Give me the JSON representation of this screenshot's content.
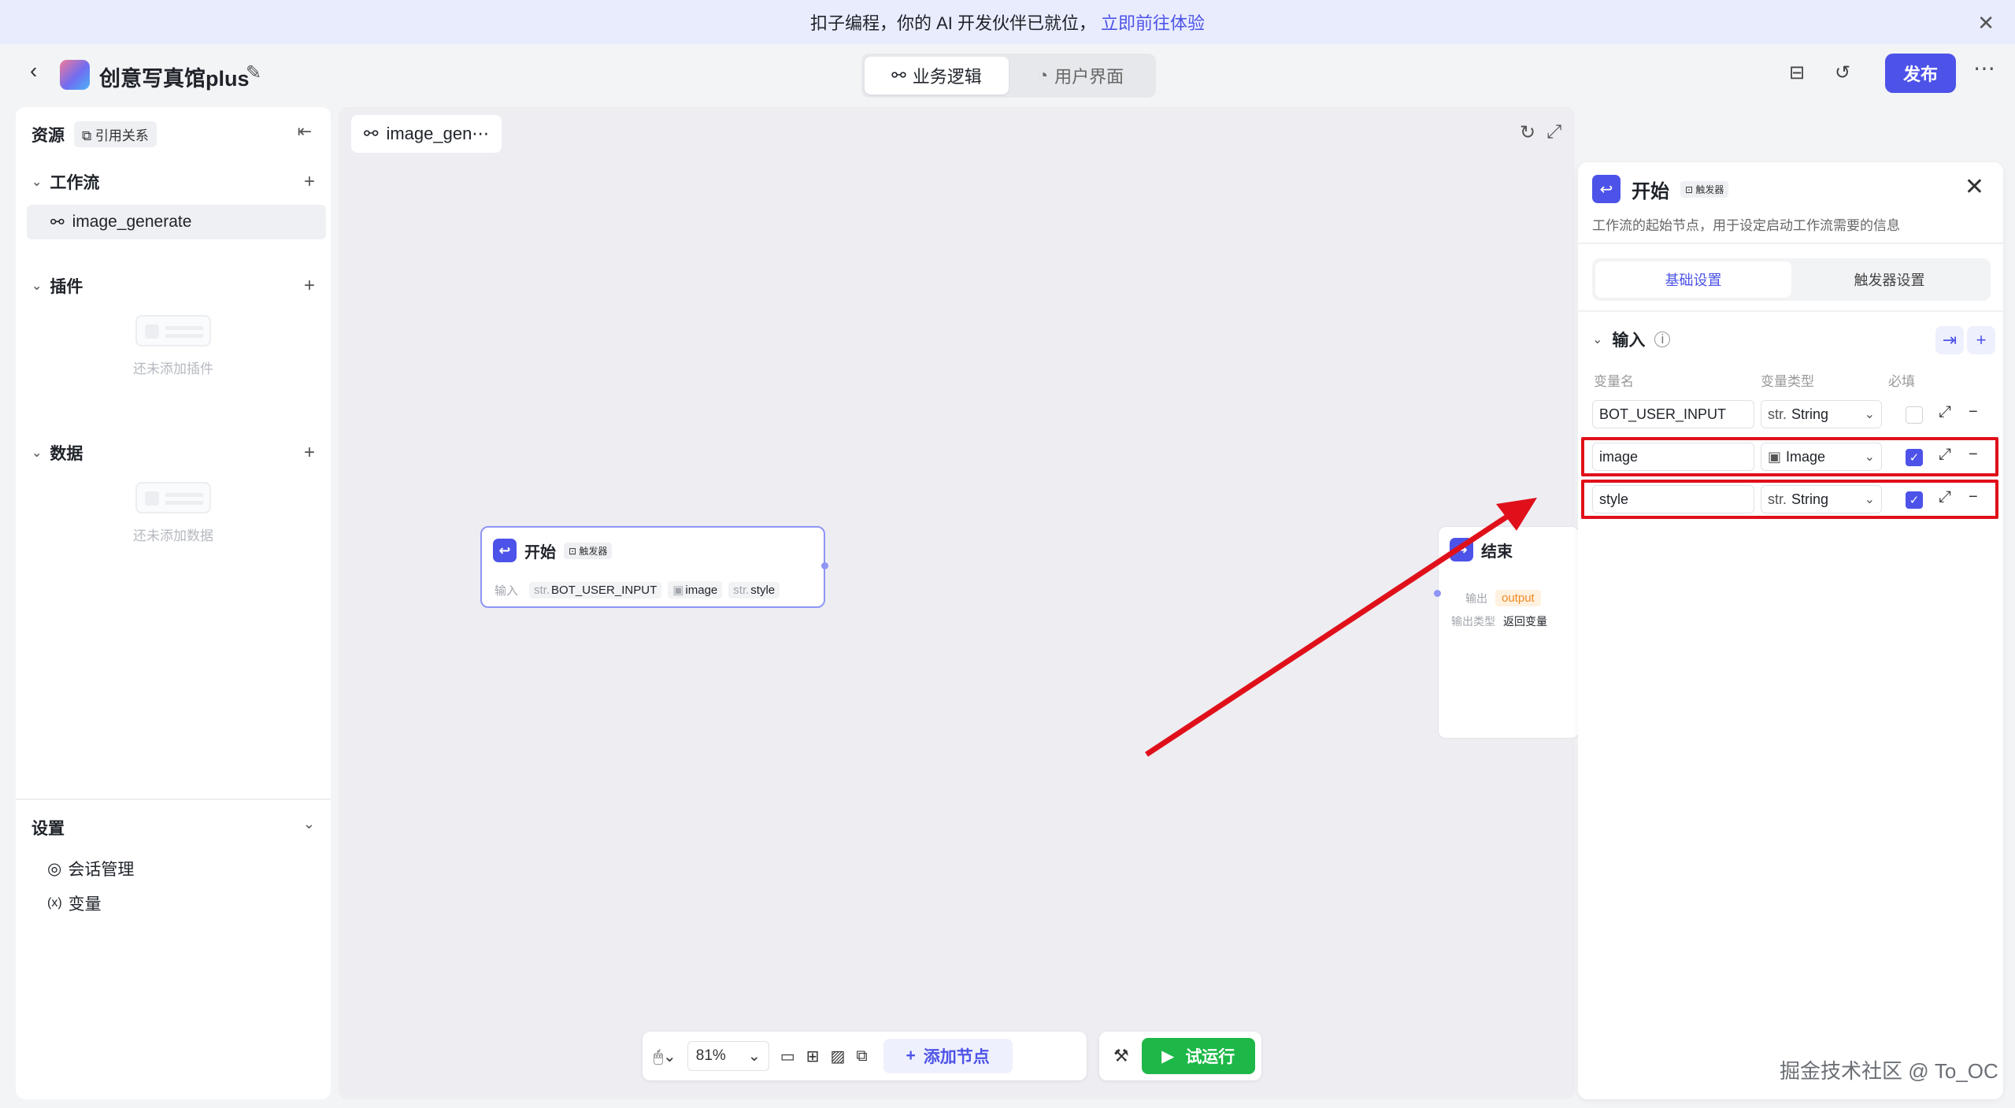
{
  "banner": {
    "text": "扣子编程，你的 AI 开发伙伴已就位，",
    "link": "立即前往体验"
  },
  "header": {
    "app_name": "创意写真馆plus",
    "tabs": [
      {
        "label": "业务逻辑"
      },
      {
        "label": "用户界面"
      }
    ],
    "publish_label": "发布"
  },
  "sidebar": {
    "resources_label": "资源",
    "ref_label": "引用关系",
    "workflow_label": "工作流",
    "workflow_item": "image_generate",
    "plugin_label": "插件",
    "plugin_empty": "还未添加插件",
    "data_label": "数据",
    "data_empty": "还未添加数据",
    "settings_label": "设置",
    "settings_items": [
      "会话管理",
      "变量"
    ]
  },
  "canvas": {
    "tab_label": "image_gen⋯",
    "start_node": {
      "title": "开始",
      "tag": "触发器",
      "input_label": "输入",
      "inputs": [
        {
          "type": "str.",
          "name": "BOT_USER_INPUT"
        },
        {
          "type": "",
          "name": "image"
        },
        {
          "type": "str.",
          "name": "style"
        }
      ]
    },
    "end_node": {
      "title": "结束",
      "output_label": "输出",
      "output_value": "output",
      "output_type_label": "输出类型",
      "output_type_value": "返回变量"
    }
  },
  "panel": {
    "title": "开始",
    "tag": "触发器",
    "description": "工作流的起始节点，用于设定启动工作流需要的信息",
    "tabs": [
      "基础设置",
      "触发器设置"
    ],
    "input_label": "输入",
    "col_name": "变量名",
    "col_type": "变量类型",
    "col_required": "必填",
    "variables": [
      {
        "name": "BOT_USER_INPUT",
        "type": "String",
        "type_prefix": "str.",
        "required": false
      },
      {
        "name": "image",
        "type": "Image",
        "type_prefix": "",
        "required": true
      },
      {
        "name": "style",
        "type": "String",
        "type_prefix": "str.",
        "required": true
      }
    ]
  },
  "toolbar": {
    "zoom": "81%",
    "add_node": "添加节点",
    "run": "试运行"
  },
  "watermark": "掘金技术社区 @ To_OC",
  "colors": {
    "accent": "#4d53e8",
    "run_green": "#1db847",
    "highlight_red": "#e0101a"
  }
}
